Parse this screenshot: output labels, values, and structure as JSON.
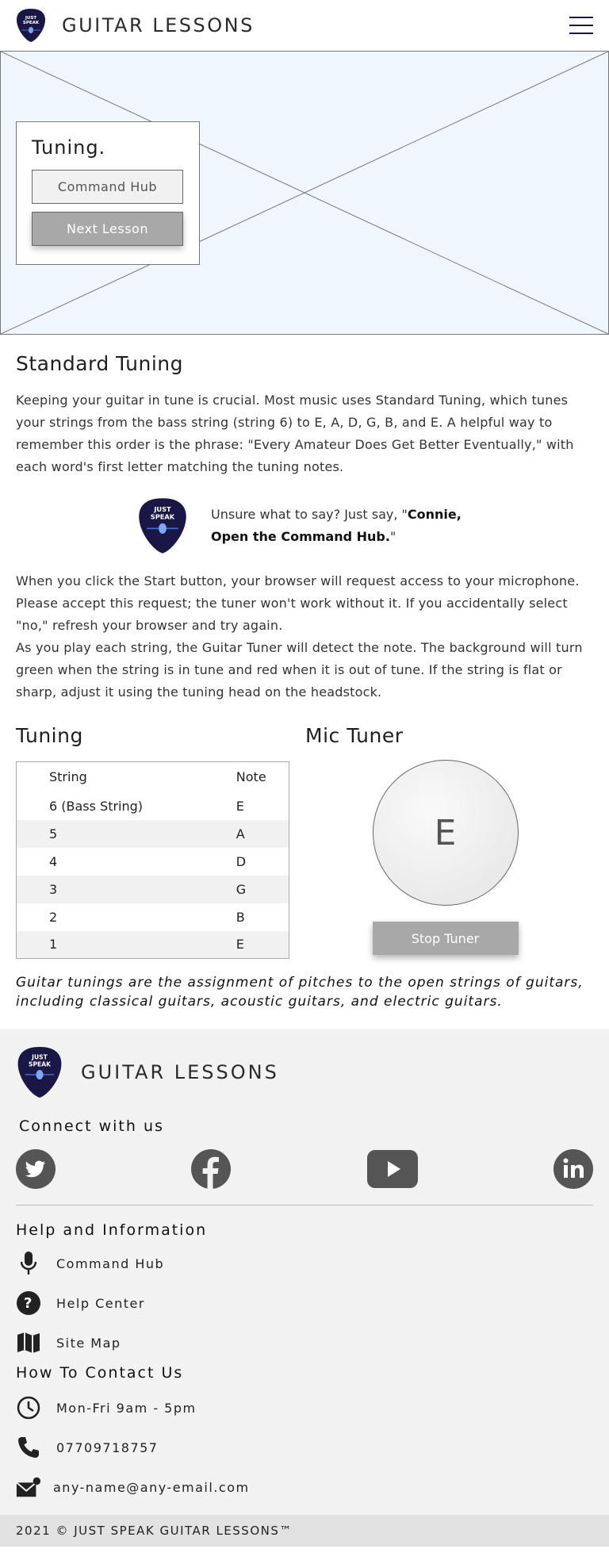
{
  "header": {
    "logo_text_line1": "JUST",
    "logo_text_line2": "SPEAK",
    "title": "GUITAR LESSONS"
  },
  "hero": {
    "card_title": "Tuning.",
    "command_hub_label": "Command Hub",
    "next_lesson_label": "Next Lesson"
  },
  "intro": {
    "heading": "Standard Tuning",
    "paragraph": "Keeping your guitar in tune is crucial. Most music uses Standard Tuning, which tunes your strings from the bass string (string 6) to E, A, D, G, B, and E. A helpful way to remember this order is the phrase: \"Every Amateur Does Get Better Eventually,\" with each word's first letter matching the tuning notes."
  },
  "tip": {
    "prefix": "Unsure what to say? Just say, \"",
    "phrase": "Connie, Open the Command Hub.",
    "suffix": "\""
  },
  "instructions": {
    "para1": "When you click the Start button, your browser will request access to your microphone. Please accept this request; the tuner won't work without it. If you accidentally select \"no,\" refresh your browser and try again.",
    "para2": "As you play each string, the Guitar Tuner will detect the note. The background will turn green when the string is in tune and red when it is out of tune. If the string is flat or sharp, adjust it using the tuning head on the headstock."
  },
  "tuning_table": {
    "heading": "Tuning",
    "columns": [
      "String",
      "Note"
    ],
    "rows": [
      [
        "6 (Bass String)",
        "E"
      ],
      [
        "5",
        "A"
      ],
      [
        "4",
        "D"
      ],
      [
        "3",
        "G"
      ],
      [
        "2",
        "B"
      ],
      [
        "1",
        "E"
      ]
    ]
  },
  "mic_tuner": {
    "heading": "Mic Tuner",
    "current_note": "E",
    "stop_label": "Stop Tuner"
  },
  "caption": "Guitar tunings are the assignment of pitches to the open strings of guitars, including classical guitars, acoustic guitars, and electric guitars.",
  "footer": {
    "title": "GUITAR LESSONS",
    "connect_heading": "Connect with us",
    "socials": [
      "twitter-icon",
      "facebook-icon",
      "youtube-icon",
      "linkedin-icon"
    ],
    "help_heading": "Help and Information",
    "help_links": [
      "Command Hub",
      "Help Center",
      "Site Map"
    ],
    "contact_heading": "How To Contact Us",
    "hours": "Mon-Fri 9am - 5pm",
    "phone": "07709718757",
    "email": "any-name@any-email.com",
    "copyright": "2021 © JUST SPEAK GUITAR LESSONS™"
  },
  "colors": {
    "logo_navy": "#1a1746",
    "hero_bg": "#f0f6fd",
    "button_grey": "#a8a8a8",
    "footer_bg": "#f2f2f2",
    "icon_dark": "#555555"
  }
}
